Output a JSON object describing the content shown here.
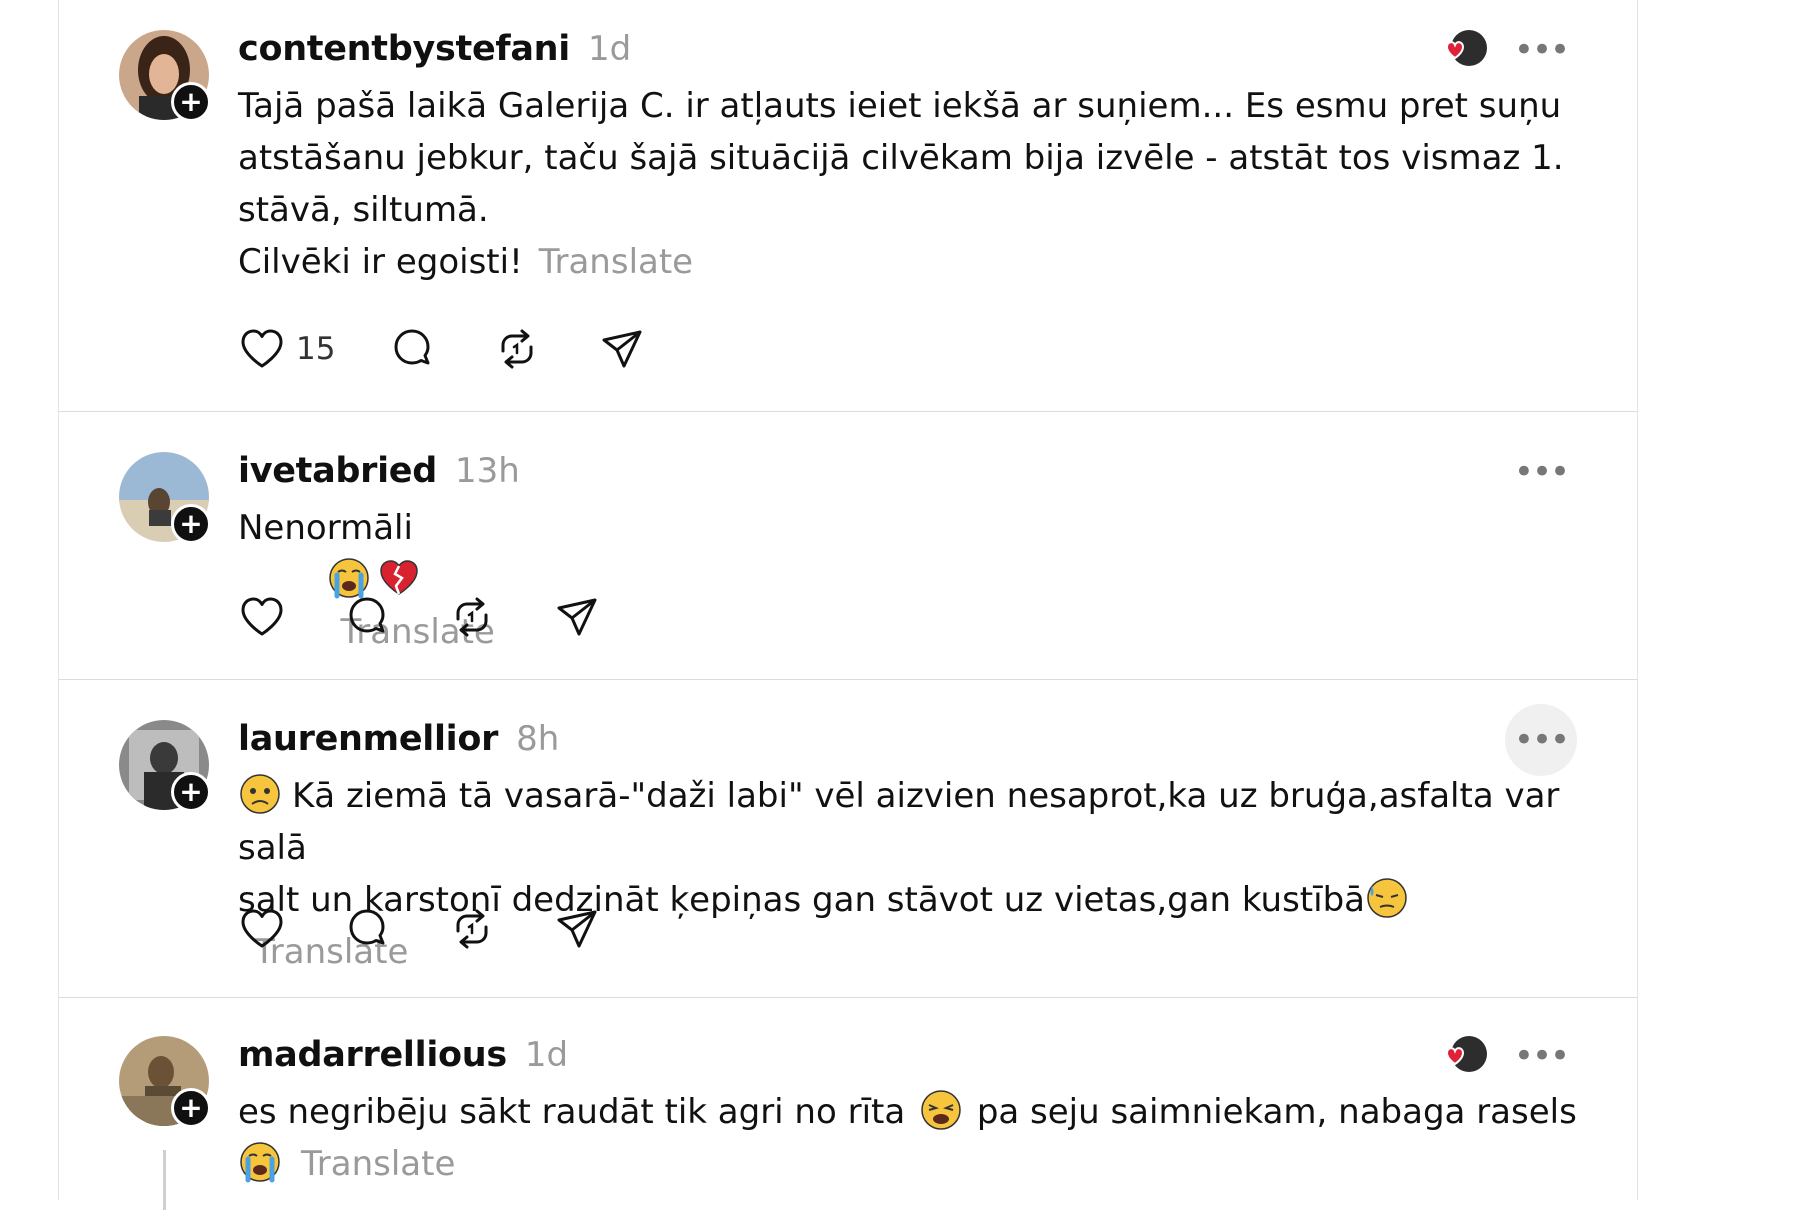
{
  "posts": [
    {
      "username": "contentbystefani",
      "time": "1d",
      "lines": [
        "Tajā pašā laikā Galerija C. ir atļauts ieiet iekšā ar suņiem... Es esmu pret suņu",
        "atstāšanu jebkur, taču šajā situācijā cilvēkam bija izvēle - atstāt tos vismaz 1.",
        "stāvā, siltumā.",
        "Cilvēki ir egoisti!"
      ],
      "translate": "Translate",
      "like_count": "15",
      "liked_by_author": true
    },
    {
      "username": "ivetabried",
      "time": "13h",
      "text": "Nenormāli",
      "emojis": [
        "crying-face",
        "broken-heart"
      ],
      "translate": "Translate"
    },
    {
      "username": "laurenmellior",
      "time": "8h",
      "lines": [
        "Kā ziemā tā vasarā-\"daži labi\" vēl aizvien nesaprot,ka uz bruģa,asfalta var salā",
        "salt un karstonī dedzināt ķepiņas gan stāvot uz vietas,gan kustībā"
      ],
      "translate": "Translate"
    },
    {
      "username": "madarrellious",
      "time": "1d",
      "lines": [
        "es negribēju sākt raudāt tik agri no rīta",
        "pa seju saimniekam, nabaga rasels"
      ],
      "translate": "Translate",
      "liked_by_author": true
    }
  ],
  "icons": {
    "like": "heart-icon",
    "reply": "comment-icon",
    "repost": "repost-icon",
    "share": "share-icon",
    "more": "more-options-icon",
    "follow": "plus-icon"
  },
  "colors": {
    "text": "#101010",
    "muted": "#9a9a9a",
    "divider": "#dcdcdc",
    "heart": "#e0213a"
  }
}
